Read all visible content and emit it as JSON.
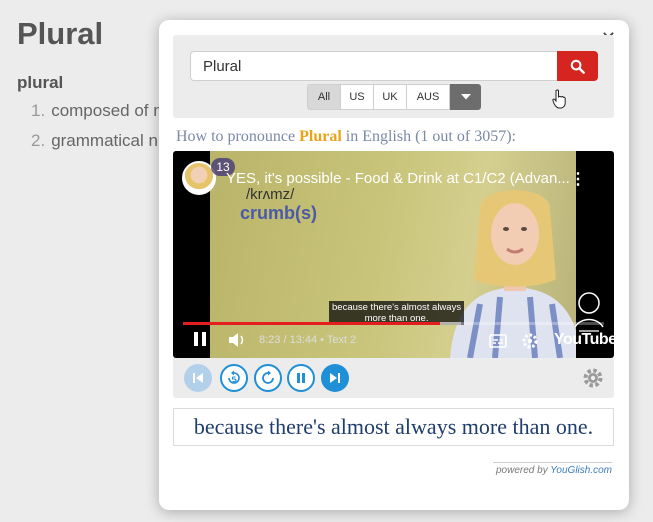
{
  "background_page": {
    "title": "Plural",
    "word": "plural",
    "definitions": [
      {
        "num": "1.",
        "text": "composed of m"
      },
      {
        "num": "2.",
        "text": "grammatical n"
      }
    ]
  },
  "popup": {
    "close_icon": "close-icon",
    "search": {
      "value": "Plural",
      "button_icon": "search-icon"
    },
    "accents": [
      {
        "label": "All",
        "active": true
      },
      {
        "label": "US",
        "active": false
      },
      {
        "label": "UK",
        "active": false
      },
      {
        "label": "AUS",
        "active": false
      }
    ],
    "how_to": {
      "prefix": "How to pronounce ",
      "word": "Plural",
      "suffix": " in English (1 out of 3057):"
    },
    "video": {
      "title": "YES, it's possible - Food & Drink at C1/C2 (Advan...",
      "badge": "13",
      "phonetic": "/krʌmz/",
      "crumb": "crumb(s)",
      "caption_line1": "because there's almost always",
      "caption_line2": "more than one.",
      "time": "8:23 / 13:44 • Text 2",
      "brand": "YouTube",
      "progress": 0.61,
      "buffered": 0.66
    },
    "caption_text": "because there's almost always more than one.",
    "powered_prefix": "powered by ",
    "powered_brand": "YouGlish.com",
    "colors": {
      "search_button": "#d42520",
      "player_blue": "#1f8fd8",
      "highlight_word": "#e8a317",
      "caption_text": "#1f3d6d"
    }
  }
}
